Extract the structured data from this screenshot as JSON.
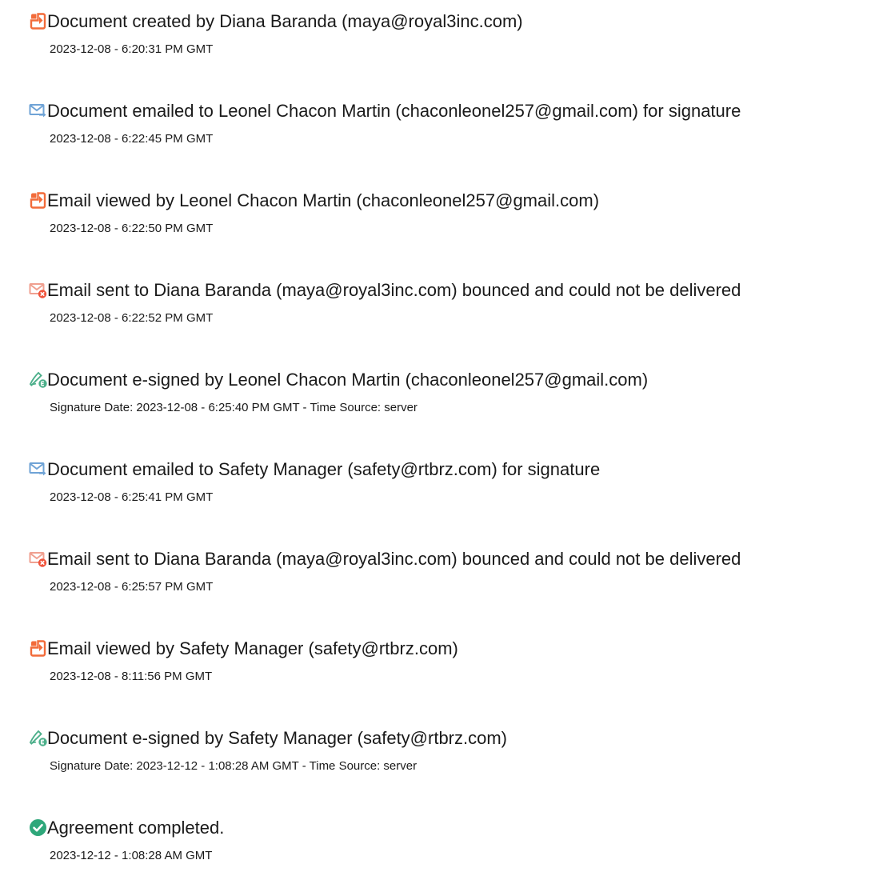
{
  "events": [
    {
      "icon": "document-created-icon",
      "title": "Document created by Diana Baranda (maya@royal3inc.com)",
      "detail": "2023-12-08 - 6:20:31 PM GMT"
    },
    {
      "icon": "document-emailed-icon",
      "title": "Document emailed to Leonel Chacon Martin (chaconleonel257@gmail.com) for signature",
      "detail": "2023-12-08 - 6:22:45 PM GMT"
    },
    {
      "icon": "email-viewed-icon",
      "title": "Email viewed by Leonel Chacon Martin (chaconleonel257@gmail.com)",
      "detail": "2023-12-08 - 6:22:50 PM GMT"
    },
    {
      "icon": "email-bounced-icon",
      "title": "Email sent to Diana Baranda (maya@royal3inc.com) bounced and could not be delivered",
      "detail": "2023-12-08 - 6:22:52 PM GMT"
    },
    {
      "icon": "e-signed-icon",
      "title": "Document e-signed by Leonel Chacon Martin (chaconleonel257@gmail.com)",
      "detail": "Signature Date: 2023-12-08 - 6:25:40 PM GMT - Time Source: server"
    },
    {
      "icon": "document-emailed-icon",
      "title": "Document emailed to Safety Manager (safety@rtbrz.com) for signature",
      "detail": "2023-12-08 - 6:25:41 PM GMT"
    },
    {
      "icon": "email-bounced-icon",
      "title": "Email sent to Diana Baranda (maya@royal3inc.com) bounced and could not be delivered",
      "detail": "2023-12-08 - 6:25:57 PM GMT"
    },
    {
      "icon": "email-viewed-icon",
      "title": "Email viewed by Safety Manager (safety@rtbrz.com)",
      "detail": "2023-12-08 - 8:11:56 PM GMT"
    },
    {
      "icon": "e-signed-icon",
      "title": "Document e-signed by Safety Manager (safety@rtbrz.com)",
      "detail": "Signature Date: 2023-12-12 - 1:08:28 AM GMT - Time Source: server"
    },
    {
      "icon": "agreement-completed-icon",
      "title": "Agreement completed.",
      "detail": "2023-12-12 - 1:08:28 AM GMT"
    }
  ],
  "colors": {
    "document_orange": "#f26b3a",
    "email_blue": "#6fa3d6",
    "bounce_red": "#f0543c",
    "signed_green": "#4caf8a",
    "completed_green": "#2ea77a"
  }
}
